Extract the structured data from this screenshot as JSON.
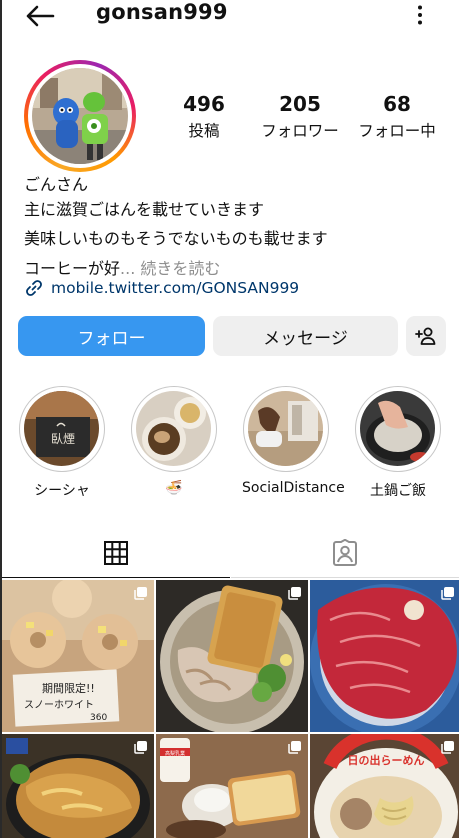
{
  "header": {
    "username": "gonsan999",
    "back_icon": "back-arrow-icon",
    "more_icon": "more-vertical-icon"
  },
  "profile": {
    "stats": [
      {
        "value": "496",
        "label": "投稿"
      },
      {
        "value": "205",
        "label": "フォロワー"
      },
      {
        "value": "68",
        "label": "フォロー中"
      }
    ],
    "name": "ごんさん",
    "bio_lines": [
      "主に滋賀ごはんを載せていきます",
      "美味しいものもそうでないものも載せます",
      "コーヒーが好"
    ],
    "bio_more": "... 続きを読む",
    "link": "mobile.twitter.com/GONSAN999"
  },
  "actions": {
    "follow": "フォロー",
    "message": "メッセージ",
    "add_user_icon": "add-user-icon"
  },
  "highlights": [
    {
      "label": "シーシャ",
      "sign_text": "臥煙"
    },
    {
      "label": "🍜"
    },
    {
      "label": "SocialDistance"
    },
    {
      "label": "土鍋ご飯"
    }
  ],
  "tabs": [
    {
      "name": "posts-grid",
      "icon": "grid-icon",
      "active": true
    },
    {
      "name": "tagged",
      "icon": "tagged-person-icon",
      "active": false
    }
  ],
  "posts": {
    "row1": [
      "donuts",
      "udon-with-tofu",
      "sliced-beef"
    ],
    "row2": [
      "katsu-bowl",
      "toast-breakfast",
      "ramen"
    ],
    "donut_sign": [
      "期間限定!!",
      "スノーホワイト",
      "360"
    ],
    "ramen_rim_text": "日の出らーめん",
    "milk_label": "高梨乳業"
  }
}
